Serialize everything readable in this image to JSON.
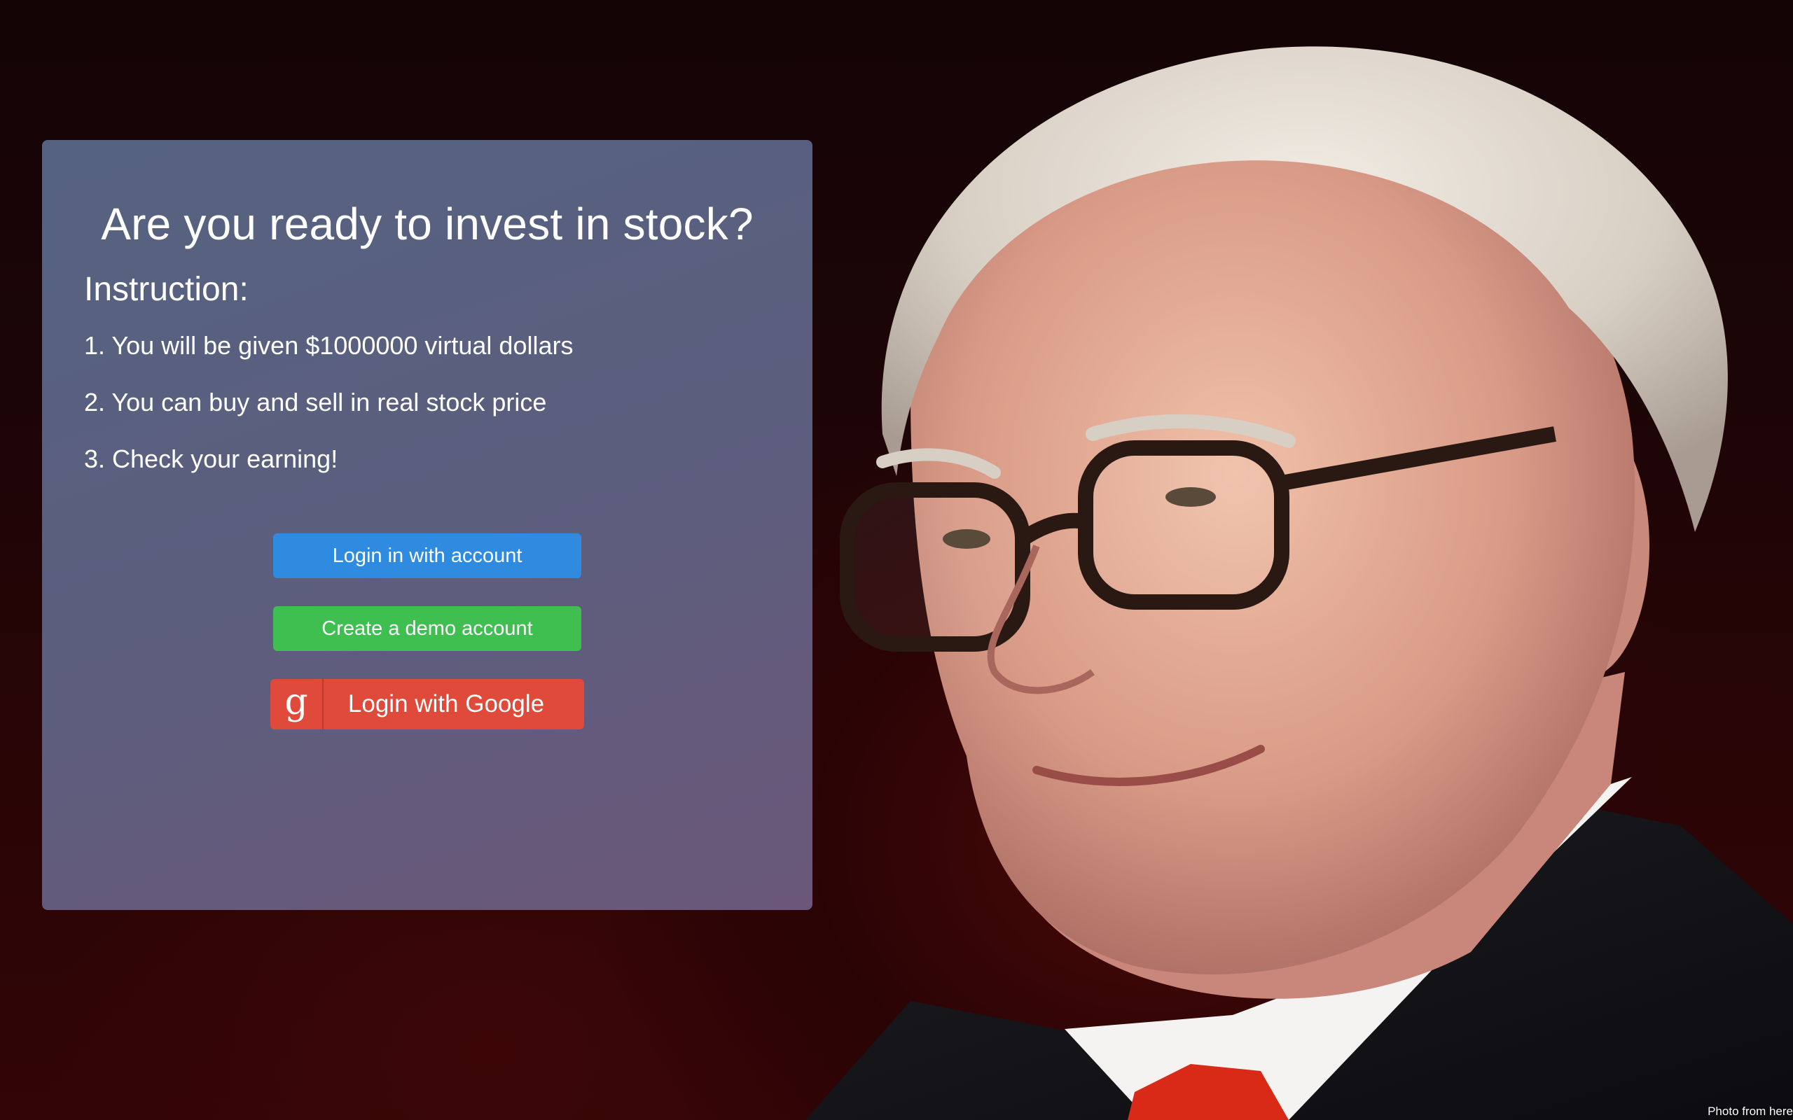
{
  "background": {
    "photo_icon": "portrait-photo",
    "colors": {
      "backdrop_dark": "#1c0507",
      "backdrop_red": "#4a0808",
      "suit": "#15151a",
      "tie": "#d92a18"
    }
  },
  "panel": {
    "title": "Are you ready to invest in stock?",
    "instruction_heading": "Instruction:",
    "instructions": [
      "1. You will be given $1000000 virtual dollars",
      "2. You can buy and sell in real stock price",
      "3. Check your earning!"
    ]
  },
  "buttons": {
    "login_label": "Login in with account",
    "demo_label": "Create a demo account",
    "google_label": "Login with Google",
    "google_icon_glyph": "g",
    "colors": {
      "login": "#2f8be0",
      "demo": "#3fbf4f",
      "google": "#df4a3a"
    }
  },
  "credit": {
    "text": "Photo from here"
  }
}
